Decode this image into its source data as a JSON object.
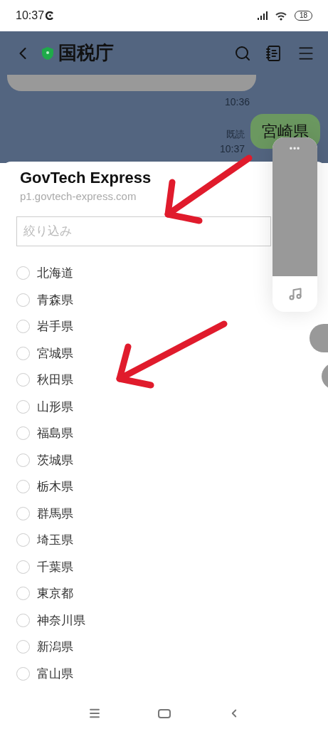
{
  "status_bar": {
    "time": "10:37",
    "battery": "18"
  },
  "header": {
    "title": "国税庁"
  },
  "chat": {
    "earlier_time": "10:36",
    "read_label": "既読",
    "sent_time": "10:37",
    "sent_message": "宮崎県"
  },
  "sheet": {
    "title": "GovTech Express",
    "url": "p1.govtech-express.com",
    "filter": {
      "placeholder": "絞り込み"
    },
    "options": [
      {
        "label": "北海道",
        "selected": false
      },
      {
        "label": "青森県",
        "selected": false
      },
      {
        "label": "岩手県",
        "selected": false
      },
      {
        "label": "宮城県",
        "selected": false
      },
      {
        "label": "秋田県",
        "selected": false
      },
      {
        "label": "山形県",
        "selected": false
      },
      {
        "label": "福島県",
        "selected": false
      },
      {
        "label": "茨城県",
        "selected": false
      },
      {
        "label": "栃木県",
        "selected": false
      },
      {
        "label": "群馬県",
        "selected": false
      },
      {
        "label": "埼玉県",
        "selected": false
      },
      {
        "label": "千葉県",
        "selected": false
      },
      {
        "label": "東京都",
        "selected": false
      },
      {
        "label": "神奈川県",
        "selected": false
      },
      {
        "label": "新潟県",
        "selected": false
      },
      {
        "label": "富山県",
        "selected": false
      }
    ]
  },
  "floating_widget": {
    "menu": "•••"
  }
}
